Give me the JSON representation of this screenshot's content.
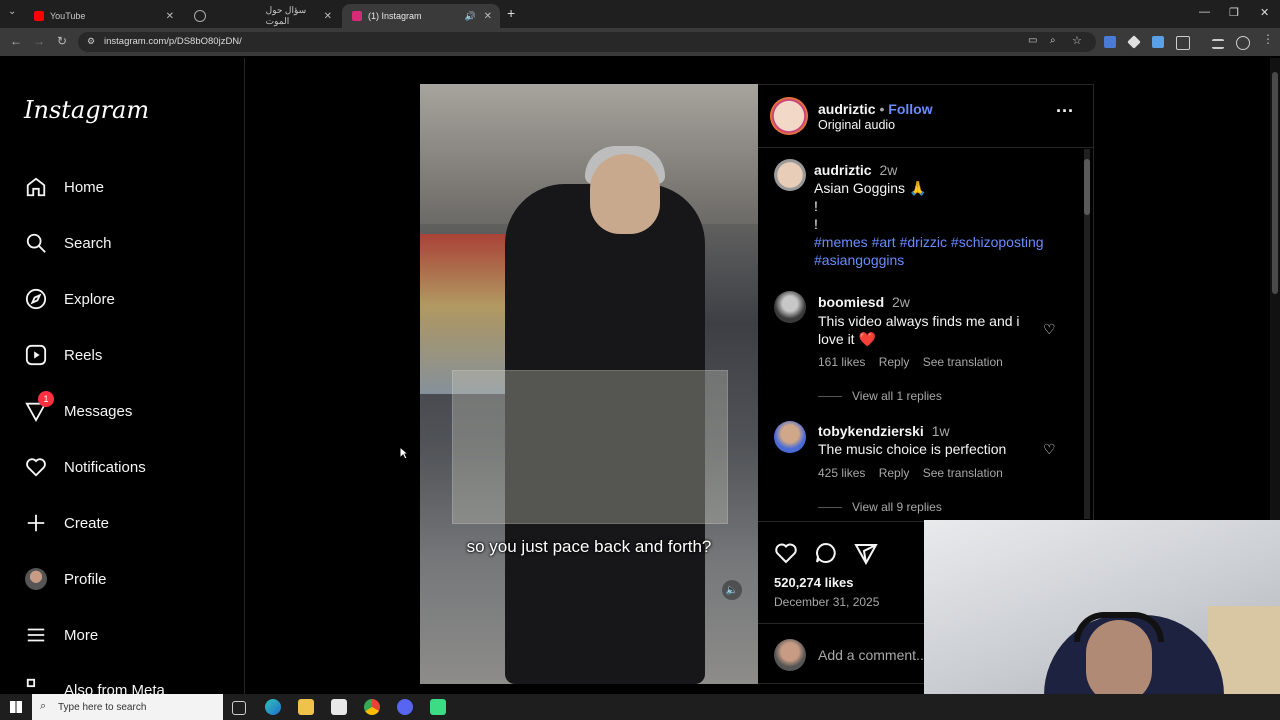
{
  "browser": {
    "tabs": [
      {
        "title": "YouTube",
        "color": "#ff0000"
      },
      {
        "title": "سؤال حول الموت",
        "color": "#aaaaaa"
      },
      {
        "title": "(1) Instagram",
        "color": "#d62976"
      }
    ],
    "url": "instagram.com/p/DS8bO80jzDN/"
  },
  "sidebar": {
    "logo": "Instagram",
    "items": [
      {
        "label": "Home",
        "icon": "home-icon"
      },
      {
        "label": "Search",
        "icon": "search-icon"
      },
      {
        "label": "Explore",
        "icon": "compass-icon"
      },
      {
        "label": "Reels",
        "icon": "reels-icon"
      },
      {
        "label": "Messages",
        "icon": "messenger-icon",
        "badge": "1"
      },
      {
        "label": "Notifications",
        "icon": "heart-icon"
      },
      {
        "label": "Create",
        "icon": "plus-icon"
      },
      {
        "label": "Profile",
        "icon": "avatar"
      },
      {
        "label": "More",
        "icon": "menu-icon"
      },
      {
        "label": "Also from Meta",
        "icon": "meta-icon"
      }
    ]
  },
  "post": {
    "author": "audriztic",
    "follow": "Follow",
    "audio": "Original audio",
    "video_caption": "so you just pace back and forth?",
    "caption": {
      "user": "audriztic",
      "time": "2w",
      "line1": "Asian Goggins 🙏",
      "line2": "!",
      "line3": "!",
      "hashtags1": "#memes #art #drizzic #schizoposting",
      "hashtags2": "#asiangoggins"
    },
    "comments": [
      {
        "user": "boomiesd",
        "time": "2w",
        "text": "This video always finds me and i love it ❤️",
        "likes": "161 likes",
        "reply": "Reply",
        "translate": "See translation",
        "view_replies": "View all 1 replies"
      },
      {
        "user": "tobykendzierski",
        "time": "1w",
        "text": "The music choice is perfection",
        "likes": "425 likes",
        "reply": "Reply",
        "translate": "See translation",
        "view_replies": "View all 9 replies"
      }
    ],
    "likes": "520,274 likes",
    "date": "December 31, 2025",
    "add_comment": "Add a comment..."
  },
  "taskbar": {
    "search_placeholder": "Type here to search"
  },
  "colors": {
    "link": "#6a8cff",
    "badge": "#ff3040"
  }
}
